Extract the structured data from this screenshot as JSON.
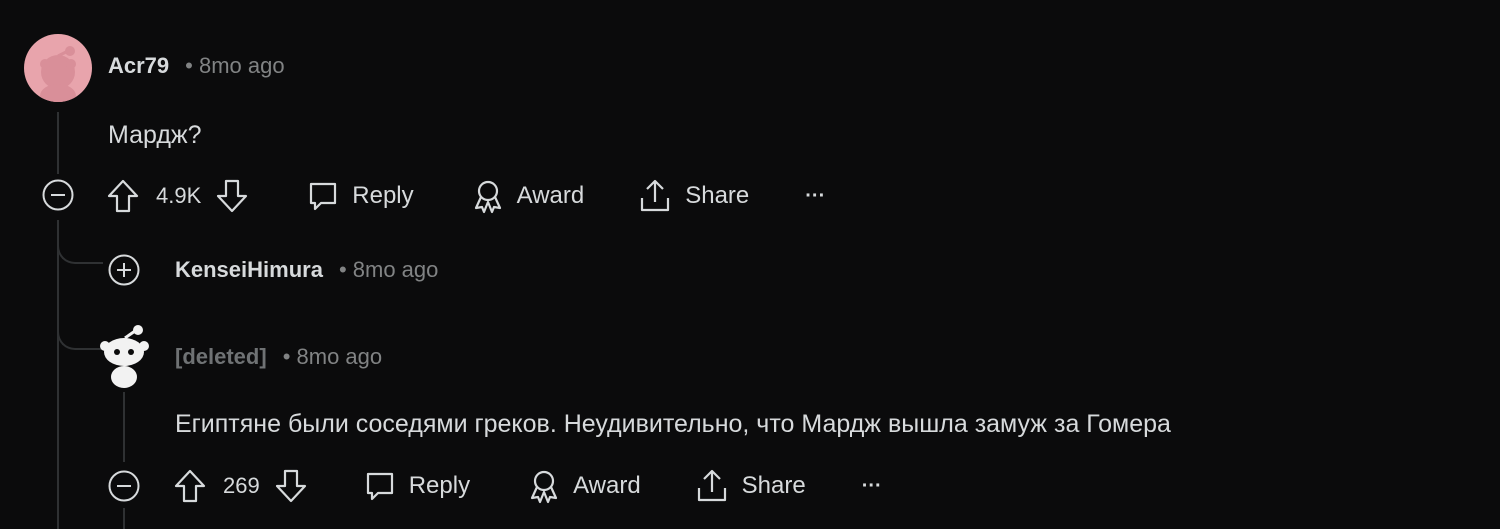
{
  "comments": [
    {
      "username": "Acr79",
      "time": "• 8mo ago",
      "text": "Мардж?",
      "votes": "4.9K",
      "reply": "Reply",
      "award": "Award",
      "share": "Share",
      "more": "···",
      "avatar_color": "#e8a4ac"
    },
    {
      "username": "KenseiHimura",
      "time": "• 8mo ago",
      "collapsed": true
    },
    {
      "username": "[deleted]",
      "time": "• 8mo ago",
      "text": "Египтяне были соседями греков. Неудивительно, что Мардж вышла замуж за Гомера",
      "votes": "269",
      "reply": "Reply",
      "award": "Award",
      "share": "Share",
      "more": "···"
    }
  ],
  "colors": {
    "background": "#0b0b0c",
    "text": "#d7dadc",
    "meta": "#818384",
    "thread_line": "#2f3133"
  }
}
